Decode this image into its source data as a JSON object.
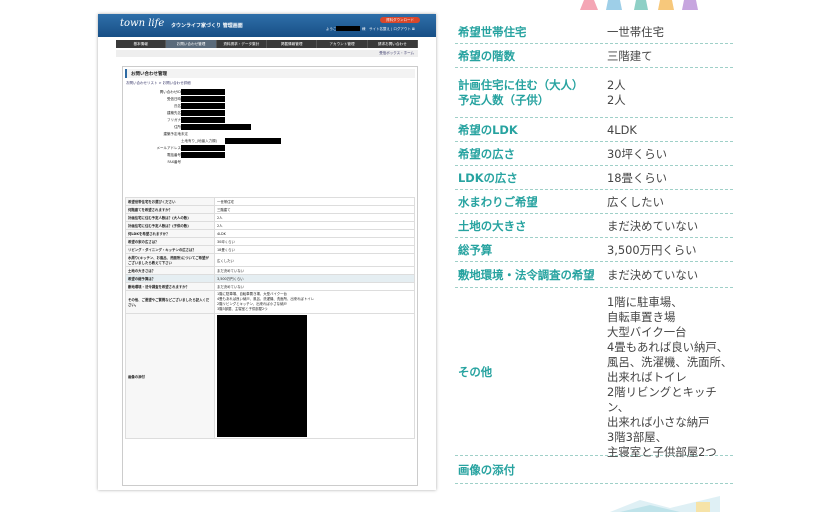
{
  "screenshot": {
    "logo": "town life",
    "logo_sub": "タウンライフ家づくり 管理画面",
    "download_button": "資料ダウンロード",
    "user_prefix": "ようこそ",
    "user_links": "様　サイト名整え | ログアウト ⊠",
    "nav": [
      "基本情報",
      "お問い合わせ管理",
      "資料請求・データ集計",
      "掲載情報管理",
      "アカウント管理",
      "請求お問い合わせ"
    ],
    "nav_active": 1,
    "crumb_right": "受信ボックス・ホーム",
    "panel_title": "お問い合わせ管理",
    "panel_crumb": "お問い合わせリスト > お問い合わせ詳細",
    "info_labels": [
      "問い合わせID",
      "受信日時",
      "氏名",
      "建築先名",
      "フリガナ",
      "住所",
      "建築予定地",
      "",
      "メールアドレス",
      "電話番号",
      "FAX番号"
    ],
    "info_text": [
      "",
      "",
      "",
      "",
      "",
      "",
      "未定",
      "土地有り_(地番入力欄)",
      "",
      "",
      ""
    ],
    "form_rows": [
      {
        "q": "希望世帯住宅をお選びください",
        "a": "一世帯住宅"
      },
      {
        "q": "何階建てを希望されますか？",
        "a": "三階建て"
      },
      {
        "q": "計画住宅に住む予定人数は？(大人の数)",
        "a": "2人"
      },
      {
        "q": "計画住宅に住む予定人数は？(子供の数)",
        "a": "2人"
      },
      {
        "q": "何LDKを希望されますか？",
        "a": "4LDK"
      },
      {
        "q": "希望の家の広さは？",
        "a": "30坪くらい"
      },
      {
        "q": "リビング・ダイニング・キッチンの広さは？",
        "a": "18畳くらい"
      },
      {
        "q": "水周り(キッチン、お風呂、洗面所)についてご希望がございましたら教えて下さい",
        "a": "広くしたい"
      },
      {
        "q": "土地の大きさは？",
        "a": "まだ決めていない"
      },
      {
        "q": "希望の総予算は？",
        "a": "3,500万円くらい"
      },
      {
        "q": "敷地環境・法令調査を希望されますか？",
        "a": "まだ決めていない"
      },
      {
        "q": "その他、ご要望やご質問などございましたら記入ください。",
        "a": "1階に駐車場、自転車置き場、大型バイク一台\n4畳もあれば良い納戸、風呂、洗濯機、洗面所、出来ればトイレ\n2階リビングとキッチン、出来れば小さな納戸\n3階3部屋、主寝室と子供部屋2つ"
      },
      {
        "q": "画像の添付",
        "a": ""
      }
    ]
  },
  "details": [
    {
      "label": "希望世帯住宅",
      "value": "一世帯住宅"
    },
    {
      "label": "希望の階数",
      "value": "三階建て"
    },
    {
      "label": "計画住宅に住む（大人）\n予定人数（子供）",
      "value": "2人\n2人"
    },
    {
      "label": "希望のLDK",
      "value": "4LDK"
    },
    {
      "label": "希望の広さ",
      "value": "30坪くらい"
    },
    {
      "label": "LDKの広さ",
      "value": "18畳くらい"
    },
    {
      "label": "水まわりご希望",
      "value": "広くしたい"
    },
    {
      "label": "土地の大きさ",
      "value": "まだ決めていない"
    },
    {
      "label": "総予算",
      "value": "3,500万円くらい"
    },
    {
      "label": "敷地環境・法令調査の希望",
      "value": "まだ決めていない"
    },
    {
      "label": "その他",
      "value": "1階に駐車場、\n自転車置き場\n大型バイク一台\n4畳もあれば良い納戸、\n風呂、洗濯機、洗面所、\n出来ればトイレ\n2階リビングとキッチン、\n出来れば小さな納戸\n3階3部屋、\n主寝室と子供部屋2つ"
    },
    {
      "label": "画像の添付",
      "value": ""
    }
  ]
}
